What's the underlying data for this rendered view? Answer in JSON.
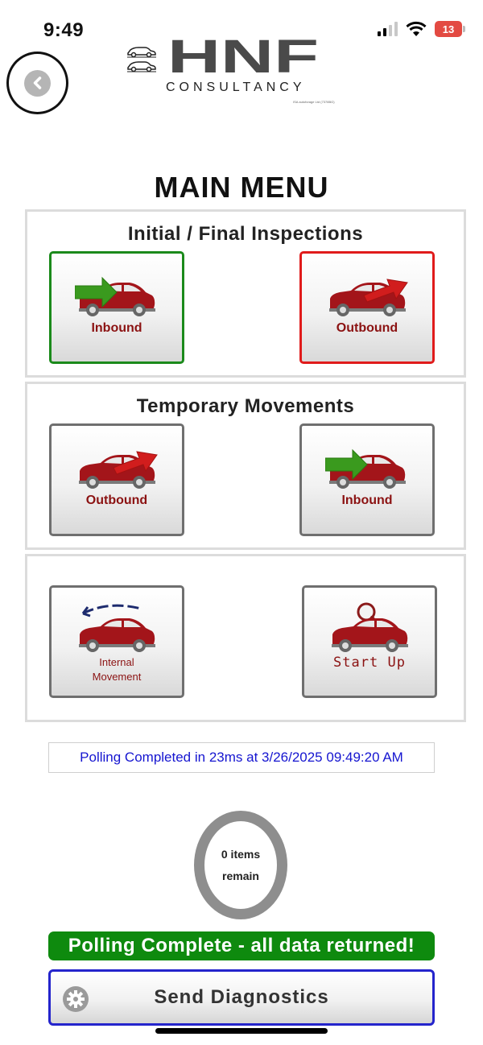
{
  "status_bar": {
    "time": "9:49",
    "battery": "13"
  },
  "logo": {
    "main": "HNF",
    "sub": "CONSULTANCY",
    "tiny": "ISA autoforage Ltd (7378BG)"
  },
  "title": "MAIN MENU",
  "sections": [
    {
      "title": "Initial / Final Inspections",
      "tiles": [
        {
          "label": "Inbound"
        },
        {
          "label": "Outbound"
        }
      ]
    },
    {
      "title": "Temporary Movements",
      "tiles": [
        {
          "label": "Outbound"
        },
        {
          "label": "Inbound"
        }
      ]
    },
    {
      "title": "",
      "tiles": [
        {
          "label_line1": "Internal",
          "label_line2": "Movement"
        },
        {
          "label": "Start Up"
        }
      ]
    }
  ],
  "polling": {
    "status_text": "Polling Completed in 23ms at 3/26/2025 09:49:20 AM"
  },
  "counter": {
    "line1": "0 items",
    "line2": "remain"
  },
  "banner": "Polling Complete - all data returned!",
  "diagnostics": {
    "label": "Send Diagnostics"
  },
  "colors": {
    "inbound_border": "#1b8a1b",
    "outbound_border": "#e01b1b",
    "car": "#a3151a",
    "banner": "#0e8a0e",
    "status_text": "#1515d0",
    "diag_border": "#2424cc"
  },
  "icons": {
    "back": "chevron-left-icon",
    "gear": "gear-icon",
    "car": "car-icon"
  }
}
